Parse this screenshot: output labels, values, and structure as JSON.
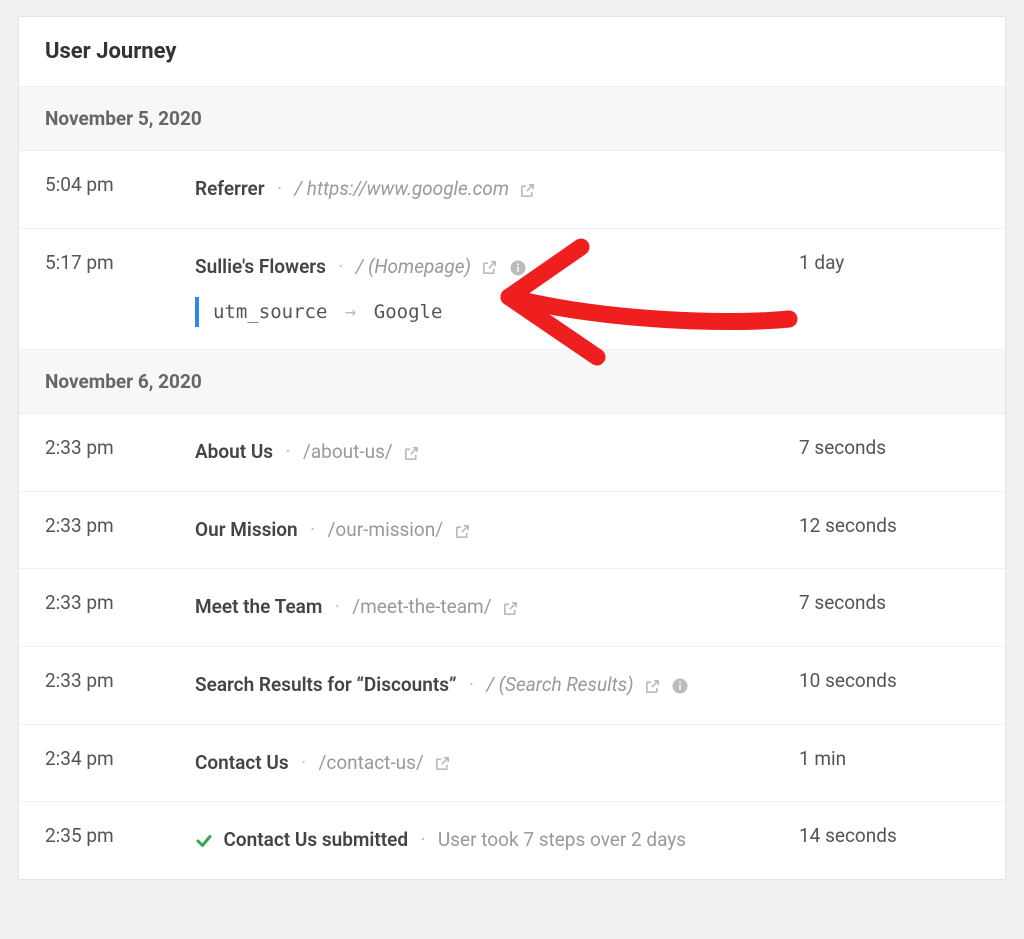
{
  "panel": {
    "title": "User Journey"
  },
  "dates": {
    "d1": "November 5, 2020",
    "d2": "November 6, 2020"
  },
  "rows": {
    "r1": {
      "time": "5:04 pm",
      "title": "Referrer",
      "path": "/ https://www.google.com",
      "duration": ""
    },
    "r2": {
      "time": "5:17 pm",
      "title": "Sullie's Flowers",
      "path": "/ (Homepage)",
      "duration": "1 day",
      "utm_key": "utm_source",
      "utm_value": "Google"
    },
    "r3": {
      "time": "2:33 pm",
      "title": "About Us",
      "path": "/about-us/",
      "duration": "7 seconds"
    },
    "r4": {
      "time": "2:33 pm",
      "title": "Our Mission",
      "path": "/our-mission/",
      "duration": "12 seconds"
    },
    "r5": {
      "time": "2:33 pm",
      "title": "Meet the Team",
      "path": "/meet-the-team/",
      "duration": "7 seconds"
    },
    "r6": {
      "time": "2:33 pm",
      "title": "Search Results for “Discounts”",
      "path": "/ (Search Results)",
      "duration": "10 seconds"
    },
    "r7": {
      "time": "2:34 pm",
      "title": "Contact Us",
      "path": "/contact-us/",
      "duration": "1 min"
    },
    "r8": {
      "time": "2:35 pm",
      "title": "Contact Us submitted",
      "desc": "User took 7 steps over 2 days",
      "duration": "14 seconds"
    }
  }
}
